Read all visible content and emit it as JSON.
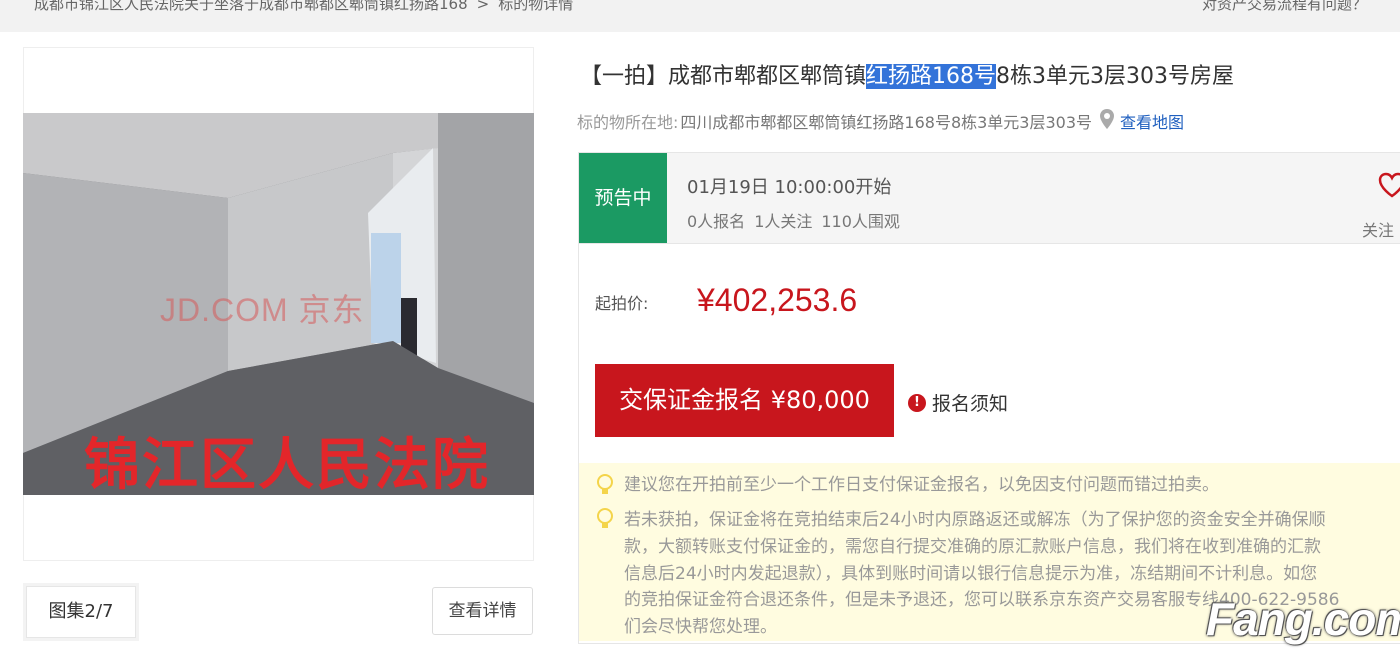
{
  "breadcrumb": {
    "item1": "成都市锦江区人民法院关于坐落于成都市郫都区郫筒镇红扬路168",
    "separator": ">",
    "item2": "标的物详情"
  },
  "help_text": "对资产交易流程有问题？",
  "gallery": {
    "watermark": "JD.COM 京东",
    "court_label": "锦江区人民法院",
    "counter": "图集2/7",
    "detail_button": "查看详情"
  },
  "title": {
    "prefix": "【一拍】成都市郫都区郫筒镇",
    "highlight": "红扬路168号",
    "suffix": "8栋3单元3层303号房屋"
  },
  "location": {
    "label": "标的物所在地:",
    "address": "四川成都市郫都区郫筒镇红扬路168号8栋3单元3层303号",
    "map_link": "查看地图"
  },
  "status": {
    "badge": "预告中",
    "start_time": "01月19日 10:00:00开始",
    "registered": "0人报名",
    "followers": "1人关注",
    "viewers": "110人围观",
    "follow_label": "关注"
  },
  "price": {
    "label": "起拍价:",
    "value": "¥402,253.6"
  },
  "deposit_button": "交保证金报名 ¥80,000",
  "notice_link": "报名须知",
  "tips": {
    "tip1": "建议您在开拍前至少一个工作日支付保证金报名，以免因支付问题而错过拍卖。",
    "tip2_line1": "若未获拍，保证金将在竞拍结束后24小时内原路返还或解冻（为了保护您的资金安全并确保顺",
    "tip2_line2": "款，大额转账支付保证金的，需您自行提交准确的原汇款账户信息，我们将在收到准确的汇款",
    "tip2_line3": "信息后24小时内发起退款），具体到账时间请以银行信息提示为准，冻结期间不计利息。如您",
    "tip2_line4": "的竞拍保证金符合退还条件，但是未予退还，您可以联系京东资产交易客服专线400-622-9586",
    "tip2_line5": "们会尽快帮您处理。"
  },
  "site_watermark": "Fang.com",
  "colors": {
    "accent_red": "#c8161d",
    "status_green": "#1b9a63",
    "link_blue": "#1f5fbf",
    "tip_bg": "#fffce0"
  },
  "icons": [
    "location-pin-icon",
    "heart-icon",
    "exclamation-icon",
    "lightbulb-icon"
  ]
}
